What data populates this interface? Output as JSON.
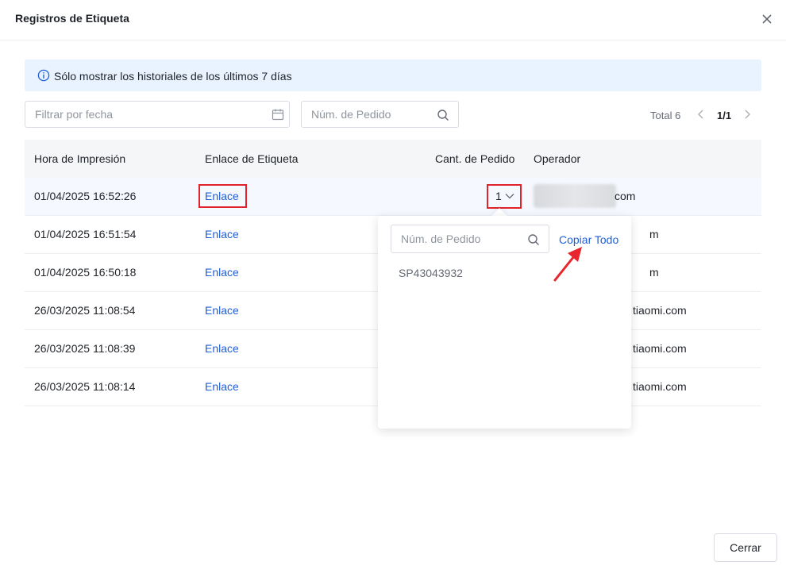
{
  "dialog": {
    "title": "Registros de Etiqueta",
    "close_icon": "close-icon",
    "close_button": "Cerrar"
  },
  "notice": {
    "icon": "info-icon",
    "text": "Sólo mostrar los historiales de los últimos 7 días"
  },
  "filters": {
    "date_placeholder": "Filtrar por fecha",
    "order_placeholder": "Núm. de Pedido"
  },
  "pagination": {
    "total": "Total 6",
    "current": "1/1"
  },
  "table": {
    "headers": [
      "Hora de Impresión",
      "Enlace de Etiqueta",
      "Cant. de Pedido",
      "Operador"
    ],
    "rows": [
      {
        "time": "01/04/2025 16:52:26",
        "link": "Enlace",
        "qty": "1",
        "operator": "com"
      },
      {
        "time": "01/04/2025 16:51:54",
        "link": "Enlace",
        "qty": "",
        "operator": "m"
      },
      {
        "time": "01/04/2025 16:50:18",
        "link": "Enlace",
        "qty": "",
        "operator": "m"
      },
      {
        "time": "26/03/2025 11:08:54",
        "link": "Enlace",
        "qty": "",
        "operator": "tiaomi.com"
      },
      {
        "time": "26/03/2025 11:08:39",
        "link": "Enlace",
        "qty": "",
        "operator": "tiaomi.com"
      },
      {
        "time": "26/03/2025 11:08:14",
        "link": "Enlace",
        "qty": "",
        "operator": "tiaomi.com"
      }
    ]
  },
  "popover": {
    "search_placeholder": "Núm. de Pedido",
    "copy_all": "Copiar Todo",
    "items": [
      "SP43043932"
    ]
  },
  "colors": {
    "link": "#1f5fd6",
    "notice_bg": "#e8f3ff",
    "highlight": "#e0232b"
  }
}
